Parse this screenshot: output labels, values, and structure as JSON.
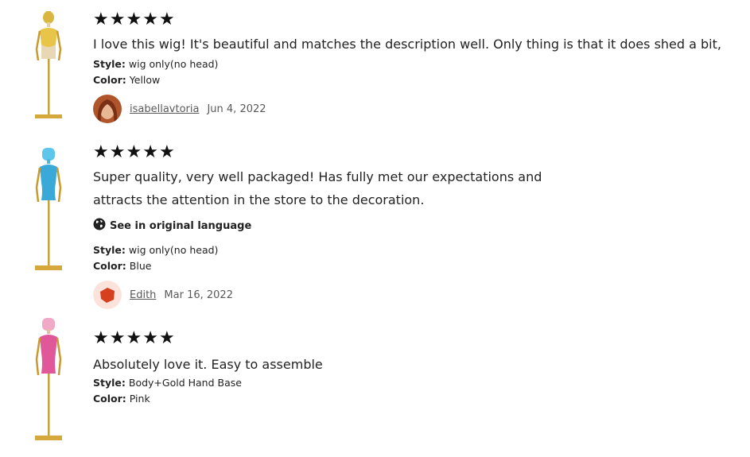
{
  "colors": {
    "star": "#111111",
    "text": "#222222",
    "muted": "#595959",
    "gold": "#d4a83a"
  },
  "star_glyph": "★",
  "reviews": [
    {
      "rating": 5,
      "text_line1": "I love this wig! It's beautiful and matches the description well. Only thing is that it does shed a bit,",
      "style_label": "Style:",
      "style_value": "wig only(no head)",
      "color_label": "Color:",
      "color_value": "Yellow",
      "author": "isabellavtoria",
      "date": "Jun 4, 2022",
      "mannequin_color": "#e8c548"
    },
    {
      "rating": 5,
      "text_line1": "Super quality, very well packaged! Has fully met our expectations and",
      "text_line2": "attracts the attention in the store to the decoration.",
      "see_original": "See in original language",
      "style_label": "Style:",
      "style_value": "wig only(no head)",
      "color_label": "Color:",
      "color_value": "Blue",
      "author": "Edith",
      "date": "Mar 16, 2022",
      "mannequin_color": "#3aa9d8"
    },
    {
      "rating": 5,
      "text_line1": "Absolutely love it. Easy to assemble",
      "style_label": "Style:",
      "style_value": "Body+Gold Hand Base",
      "color_label": "Color:",
      "color_value": "Pink",
      "mannequin_color": "#e0579a"
    }
  ]
}
